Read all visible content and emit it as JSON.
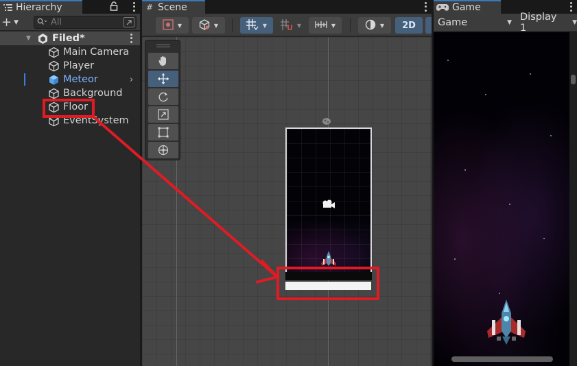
{
  "colors": {
    "accent_blue": "#3a79bb",
    "selected_text_blue": "#7cb4ff",
    "annotation_red": "#e01b24"
  },
  "hierarchy": {
    "tab_label": "Hierarchy",
    "tab_icon": "list-icon",
    "search_placeholder": "All",
    "scene_name": "Filed*",
    "items": [
      {
        "label": "Main Camera",
        "icon": "cube-icon"
      },
      {
        "label": "Player",
        "icon": "cube-icon"
      },
      {
        "label": "Meteor",
        "icon": "prefab-cube-icon",
        "has_children": true
      },
      {
        "label": "Background",
        "icon": "cube-icon"
      },
      {
        "label": "Floor",
        "icon": "cube-icon",
        "annotated": true
      },
      {
        "label": "EventSystem",
        "icon": "cube-icon"
      }
    ]
  },
  "scene": {
    "tab_label": "Scene",
    "tab_icon": "grid-hash-icon",
    "toolbar": {
      "mode_2d_label": "2D"
    },
    "tools": [
      "hand-tool-icon",
      "move-tool-icon",
      "rotate-tool-icon",
      "scale-tool-icon",
      "rect-tool-icon",
      "transform-tool-icon"
    ],
    "active_tool": "move-tool-icon"
  },
  "game": {
    "tab_label": "Game",
    "tab_icon": "gamepad-icon",
    "mode_select": "Game",
    "display_select": "Display 1"
  }
}
